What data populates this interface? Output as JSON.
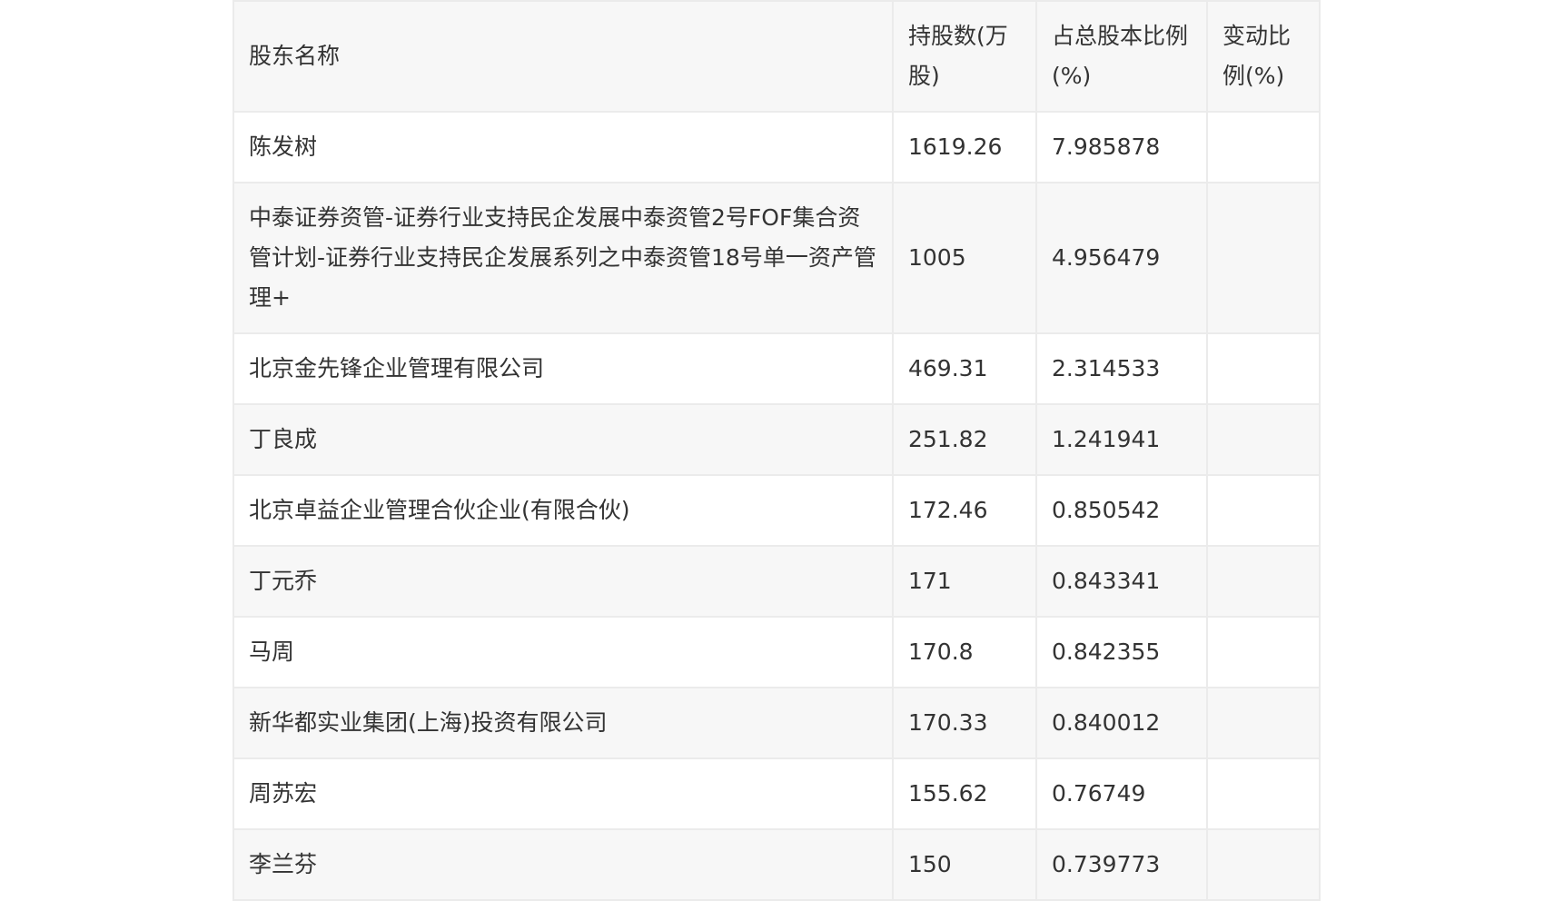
{
  "table": {
    "headers": [
      "股东名称",
      "持股数(万股)",
      "占总股本比例(%)",
      "变动比例(%)"
    ],
    "rows": [
      {
        "name": "陈发树",
        "shares": "1619.26",
        "ratio": "7.985878",
        "change": ""
      },
      {
        "name": "中泰证券资管-证券行业支持民企发展中泰资管2号FOF集合资管计划-证券行业支持民企发展系列之中泰资管18号单一资产管理+",
        "shares": "1005",
        "ratio": "4.956479",
        "change": ""
      },
      {
        "name": "北京金先锋企业管理有限公司",
        "shares": "469.31",
        "ratio": "2.314533",
        "change": ""
      },
      {
        "name": "丁良成",
        "shares": "251.82",
        "ratio": "1.241941",
        "change": ""
      },
      {
        "name": "北京卓益企业管理合伙企业(有限合伙)",
        "shares": "172.46",
        "ratio": "0.850542",
        "change": ""
      },
      {
        "name": "丁元乔",
        "shares": "171",
        "ratio": "0.843341",
        "change": ""
      },
      {
        "name": "马周",
        "shares": "170.8",
        "ratio": "0.842355",
        "change": ""
      },
      {
        "name": "新华都实业集团(上海)投资有限公司",
        "shares": "170.33",
        "ratio": "0.840012",
        "change": ""
      },
      {
        "name": "周苏宏",
        "shares": "155.62",
        "ratio": "0.76749",
        "change": ""
      },
      {
        "name": "李兰芬",
        "shares": "150",
        "ratio": "0.739773",
        "change": ""
      }
    ]
  }
}
